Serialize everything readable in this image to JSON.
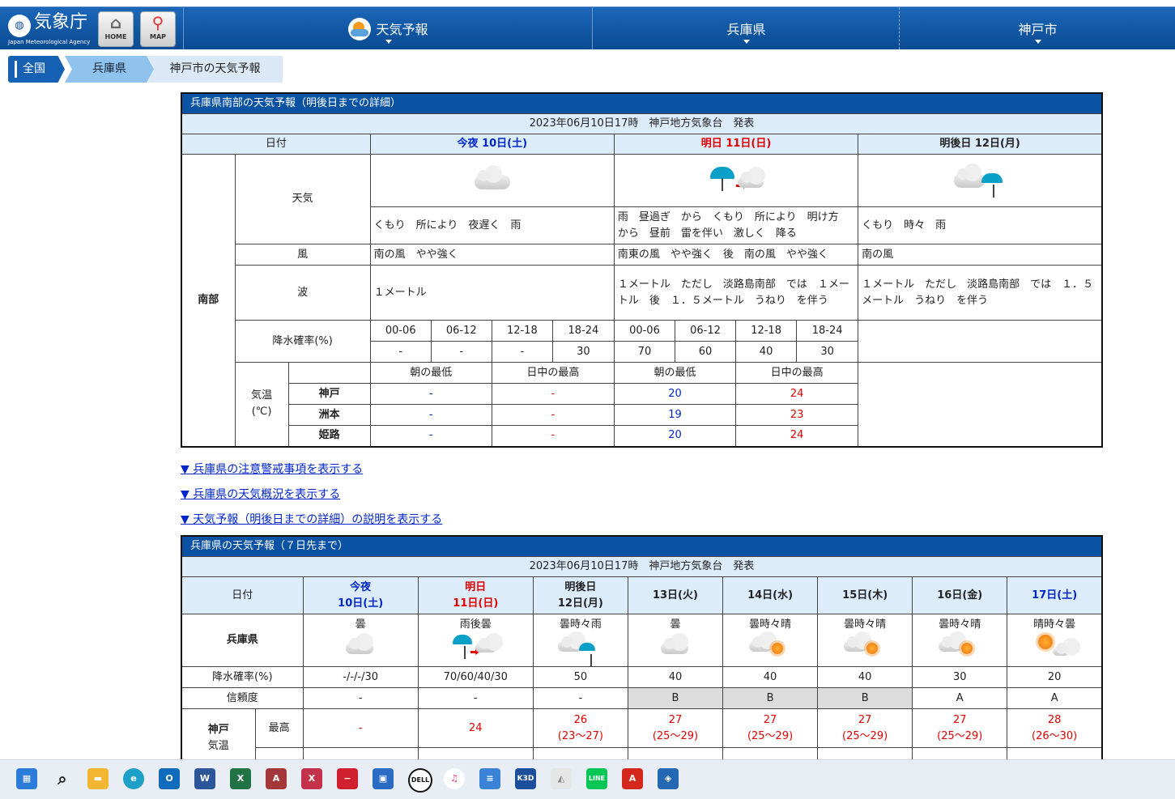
{
  "header": {
    "logo_text": "気象庁",
    "logo_sub": "Japan Meteorological Agency",
    "home_label": "HOME",
    "map_label": "MAP",
    "nav": [
      "天気予報",
      "兵庫県",
      "神戸市"
    ]
  },
  "breadcrumb": [
    "全国",
    "兵庫県",
    "神戸市の天気予報"
  ],
  "detail": {
    "title": "兵庫県南部の天気予報（明後日までの詳細）",
    "issued": "2023年06月10日17時　神戸地方気象台　発表",
    "date_label": "日付",
    "days": [
      {
        "label": "今夜 10日(土)"
      },
      {
        "label": "明日 11日(日)"
      },
      {
        "label": "明後日 12日(月)"
      }
    ],
    "region": "南部",
    "row_weather": "天気",
    "weather_text": [
      "くもり　所により　夜遅く　雨",
      "雨　昼過ぎ　から　くもり　所により　明け方　から　昼前　雷を伴い　激しく　降る",
      "くもり　時々　雨"
    ],
    "row_wind": "風",
    "wind": [
      "南の風　やや強く",
      "南東の風　やや強く　後　南の風　やや強く",
      "南の風"
    ],
    "row_wave": "波",
    "wave": [
      "１メートル",
      "１メートル　ただし　淡路島南部　では　１メートル　後　１．５メートル　うねり　を伴う",
      "１メートル　ただし　淡路島南部　では　１．５メートル　うねり　を伴う"
    ],
    "row_pop": "降水確率(%)",
    "pop_times": [
      "00-06",
      "06-12",
      "12-18",
      "18-24",
      "00-06",
      "06-12",
      "12-18",
      "18-24"
    ],
    "pop_values": [
      "-",
      "-",
      "-",
      "30",
      "70",
      "60",
      "40",
      "30"
    ],
    "row_temp": "気温",
    "temp_unit": "(℃)",
    "temp_heads": [
      "朝の最低",
      "日中の最高",
      "朝の最低",
      "日中の最高"
    ],
    "temps": [
      {
        "city": "神戸",
        "v": [
          "-",
          "-",
          "20",
          "24"
        ]
      },
      {
        "city": "洲本",
        "v": [
          "-",
          "-",
          "19",
          "23"
        ]
      },
      {
        "city": "姫路",
        "v": [
          "-",
          "-",
          "20",
          "24"
        ]
      }
    ]
  },
  "links": [
    "▼ 兵庫県の注意警戒事項を表示する",
    "▼ 兵庫県の天気概況を表示する",
    "▼ 天気予報（明後日までの詳細）の説明を表示する"
  ],
  "weekly": {
    "title": "兵庫県の天気予報（７日先まで）",
    "issued": "2023年06月10日17時　神戸地方気象台　発表",
    "date_label": "日付",
    "days": [
      {
        "l1": "今夜",
        "l2": "10日(土)"
      },
      {
        "l1": "明日",
        "l2": "11日(日)"
      },
      {
        "l1": "明後日",
        "l2": "12日(月)"
      },
      {
        "l1": "13日(火)",
        "l2": ""
      },
      {
        "l1": "14日(水)",
        "l2": ""
      },
      {
        "l1": "15日(木)",
        "l2": ""
      },
      {
        "l1": "16日(金)",
        "l2": ""
      },
      {
        "l1": "17日(土)",
        "l2": ""
      }
    ],
    "pref": "兵庫県",
    "weather": [
      "曇",
      "雨後曇",
      "曇時々雨",
      "曇",
      "曇時々晴",
      "曇時々晴",
      "曇時々晴",
      "晴時々曇"
    ],
    "row_pop": "降水確率(%)",
    "pop": [
      "-/-/-/30",
      "70/60/40/30",
      "50",
      "40",
      "40",
      "40",
      "30",
      "20"
    ],
    "row_rel": "信頼度",
    "reliability": [
      "-",
      "-",
      "-",
      "B",
      "B",
      "B",
      "A",
      "A"
    ],
    "city": "神戸",
    "city_sub": "気温",
    "row_max": "最高",
    "max": [
      "-",
      "24",
      "26",
      "27",
      "27",
      "27",
      "27",
      "28"
    ],
    "max_range": [
      "",
      "",
      "(23～27)",
      "(25～29)",
      "(25～29)",
      "(25～29)",
      "(25～29)",
      "(26～30)"
    ]
  },
  "taskbar": [
    "start-icon",
    "search-icon",
    "explorer-icon",
    "edge-icon",
    "outlook-icon",
    "word-icon",
    "excel-icon",
    "access-icon",
    "app-icon",
    "app-icon",
    "store-icon",
    "dell-icon",
    "itunes-icon",
    "notepad-icon",
    "k3d-icon",
    "app-icon",
    "line-icon",
    "acrobat-icon",
    "app-icon"
  ]
}
